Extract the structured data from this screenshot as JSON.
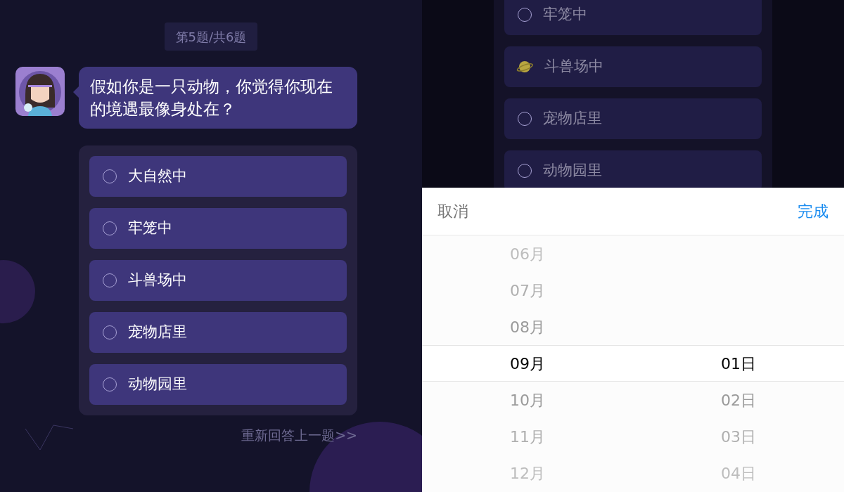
{
  "quiz_screen": {
    "progress": "第5题/共6题",
    "question": "假如你是一只动物，你觉得你现在的境遇最像身处在？",
    "options": [
      {
        "label": "大自然中",
        "selected": false
      },
      {
        "label": "牢笼中",
        "selected": false
      },
      {
        "label": "斗兽场中",
        "selected": false
      },
      {
        "label": "宠物店里",
        "selected": false
      },
      {
        "label": "动物园里",
        "selected": false
      }
    ],
    "back_link": "重新回答上一题>>"
  },
  "picker_screen": {
    "background_options": [
      {
        "label": "牢笼中",
        "selected": false
      },
      {
        "label": "斗兽场中",
        "selected": true
      },
      {
        "label": "宠物店里",
        "selected": false
      },
      {
        "label": "动物园里",
        "selected": false
      }
    ],
    "cancel": "取消",
    "confirm": "完成",
    "columns": [
      {
        "items": [
          {
            "label": "06月",
            "selected": false
          },
          {
            "label": "07月",
            "selected": false
          },
          {
            "label": "08月",
            "selected": false
          },
          {
            "label": "09月",
            "selected": true
          },
          {
            "label": "10月",
            "selected": false
          },
          {
            "label": "11月",
            "selected": false
          },
          {
            "label": "12月",
            "selected": false
          }
        ]
      },
      {
        "items": [
          {
            "label": "01日",
            "selected": true
          },
          {
            "label": "02日",
            "selected": false
          },
          {
            "label": "03日",
            "selected": false
          },
          {
            "label": "04日",
            "selected": false
          }
        ]
      }
    ]
  }
}
